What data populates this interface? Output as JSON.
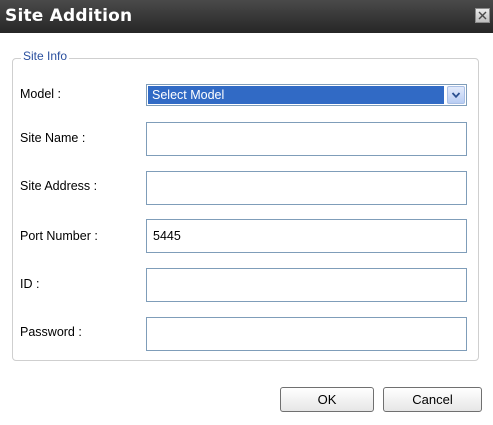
{
  "dialog": {
    "title": "Site Addition",
    "group_title": "Site Info"
  },
  "fields": {
    "model": {
      "label": "Model :",
      "selected": "Select Model"
    },
    "site_name": {
      "label": "Site Name :",
      "value": ""
    },
    "site_address": {
      "label": "Site Address :",
      "value": ""
    },
    "port_number": {
      "label": "Port Number :",
      "value": "5445"
    },
    "id": {
      "label": "ID :",
      "value": ""
    },
    "password": {
      "label": "Password :",
      "value": ""
    }
  },
  "buttons": {
    "ok": "OK",
    "cancel": "Cancel"
  },
  "icons": {
    "close": "close-icon",
    "dropdown": "chevron-down-icon"
  },
  "colors": {
    "titlebar": "#2e2e2e",
    "accent": "#316ac5",
    "group_title": "#2a4f9e"
  }
}
